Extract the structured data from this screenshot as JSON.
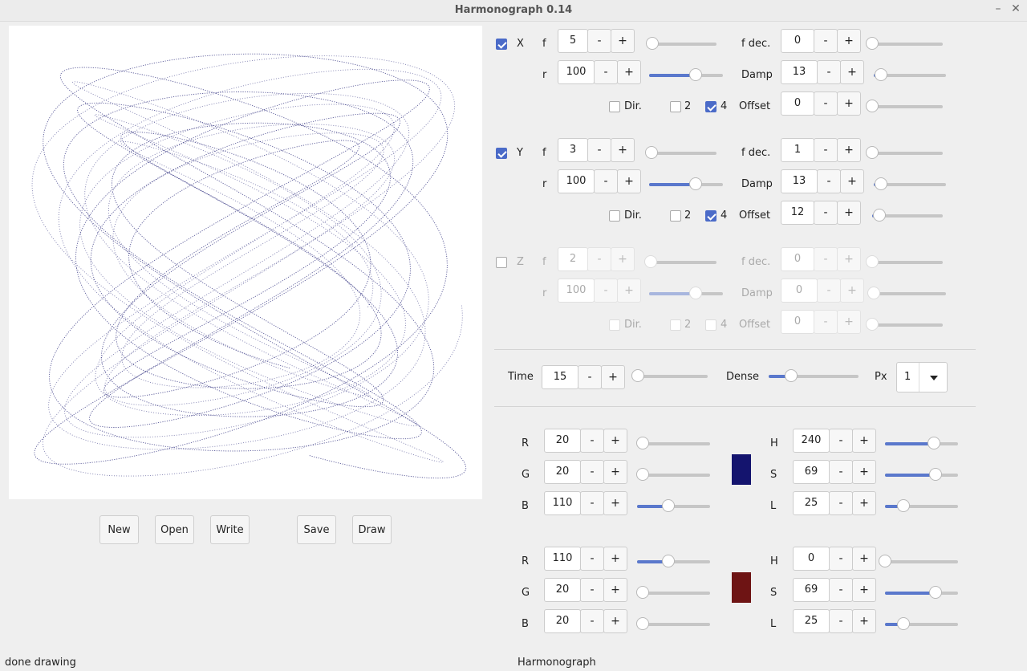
{
  "window": {
    "title": "Harmonograph 0.14",
    "minimize_icon": "minimize-icon",
    "close_icon": "close-icon"
  },
  "toolbar": {
    "new_label": "New",
    "open_label": "Open",
    "write_label": "Write",
    "save_label": "Save",
    "draw_label": "Draw"
  },
  "axes": [
    {
      "name": "X",
      "enabled": true,
      "f": "5",
      "f_level": 0.05,
      "r": "100",
      "r_level": 0.63,
      "fdec": "0",
      "fdec_level": 0.0,
      "damp": "13",
      "damp_level": 0.1,
      "dir_checked": false,
      "two_checked": false,
      "four_checked": true,
      "offset": "0",
      "offset_level": 0.0,
      "show_offset": true
    },
    {
      "name": "Y",
      "enabled": true,
      "f": "3",
      "f_level": 0.03,
      "r": "100",
      "r_level": 0.63,
      "fdec": "1",
      "fdec_level": 0.0,
      "damp": "13",
      "damp_level": 0.1,
      "dir_checked": false,
      "two_checked": false,
      "four_checked": true,
      "offset": "12",
      "offset_level": 0.1,
      "show_offset": true
    },
    {
      "name": "Z",
      "enabled": false,
      "f": "2",
      "f_level": 0.02,
      "r": "100",
      "r_level": 0.63,
      "fdec": "0",
      "fdec_level": 0.0,
      "damp": "0",
      "damp_level": 0.0,
      "dir_checked": false,
      "two_checked": false,
      "four_checked": false,
      "offset": "0",
      "offset_level": 0.0,
      "show_offset": true
    }
  ],
  "labels": {
    "f": "f",
    "r": "r",
    "fdec": "f dec.",
    "damp": "Damp",
    "offset": "Offset",
    "dir": "Dir.",
    "two": "2",
    "four": "4"
  },
  "time": {
    "label": "Time",
    "value": "15",
    "level": 0.03
  },
  "dense": {
    "label": "Dense",
    "level": 0.25
  },
  "px": {
    "label": "Px",
    "value": "1",
    "dropdown_icon": "dropdown-arrow-icon"
  },
  "step": {
    "minus": "-",
    "plus": "+"
  },
  "color1": {
    "r": "20",
    "g": "20",
    "b": "110",
    "r_level": 0.08,
    "g_level": 0.08,
    "b_level": 0.43,
    "h": "240",
    "s": "69",
    "l": "25",
    "h_level": 0.67,
    "s_level": 0.69,
    "l_level": 0.25,
    "swatch": "#14146e"
  },
  "color2": {
    "r": "110",
    "g": "20",
    "b": "20",
    "r_level": 0.43,
    "g_level": 0.08,
    "b_level": 0.08,
    "h": "0",
    "s": "69",
    "l": "25",
    "h_level": 0.0,
    "s_level": 0.69,
    "l_level": 0.25,
    "swatch": "#6e1414"
  },
  "color_labels": {
    "r": "R",
    "g": "G",
    "b": "B",
    "h": "H",
    "s": "S",
    "l": "L"
  },
  "status": {
    "left": "done drawing",
    "right": "Harmonograph"
  }
}
